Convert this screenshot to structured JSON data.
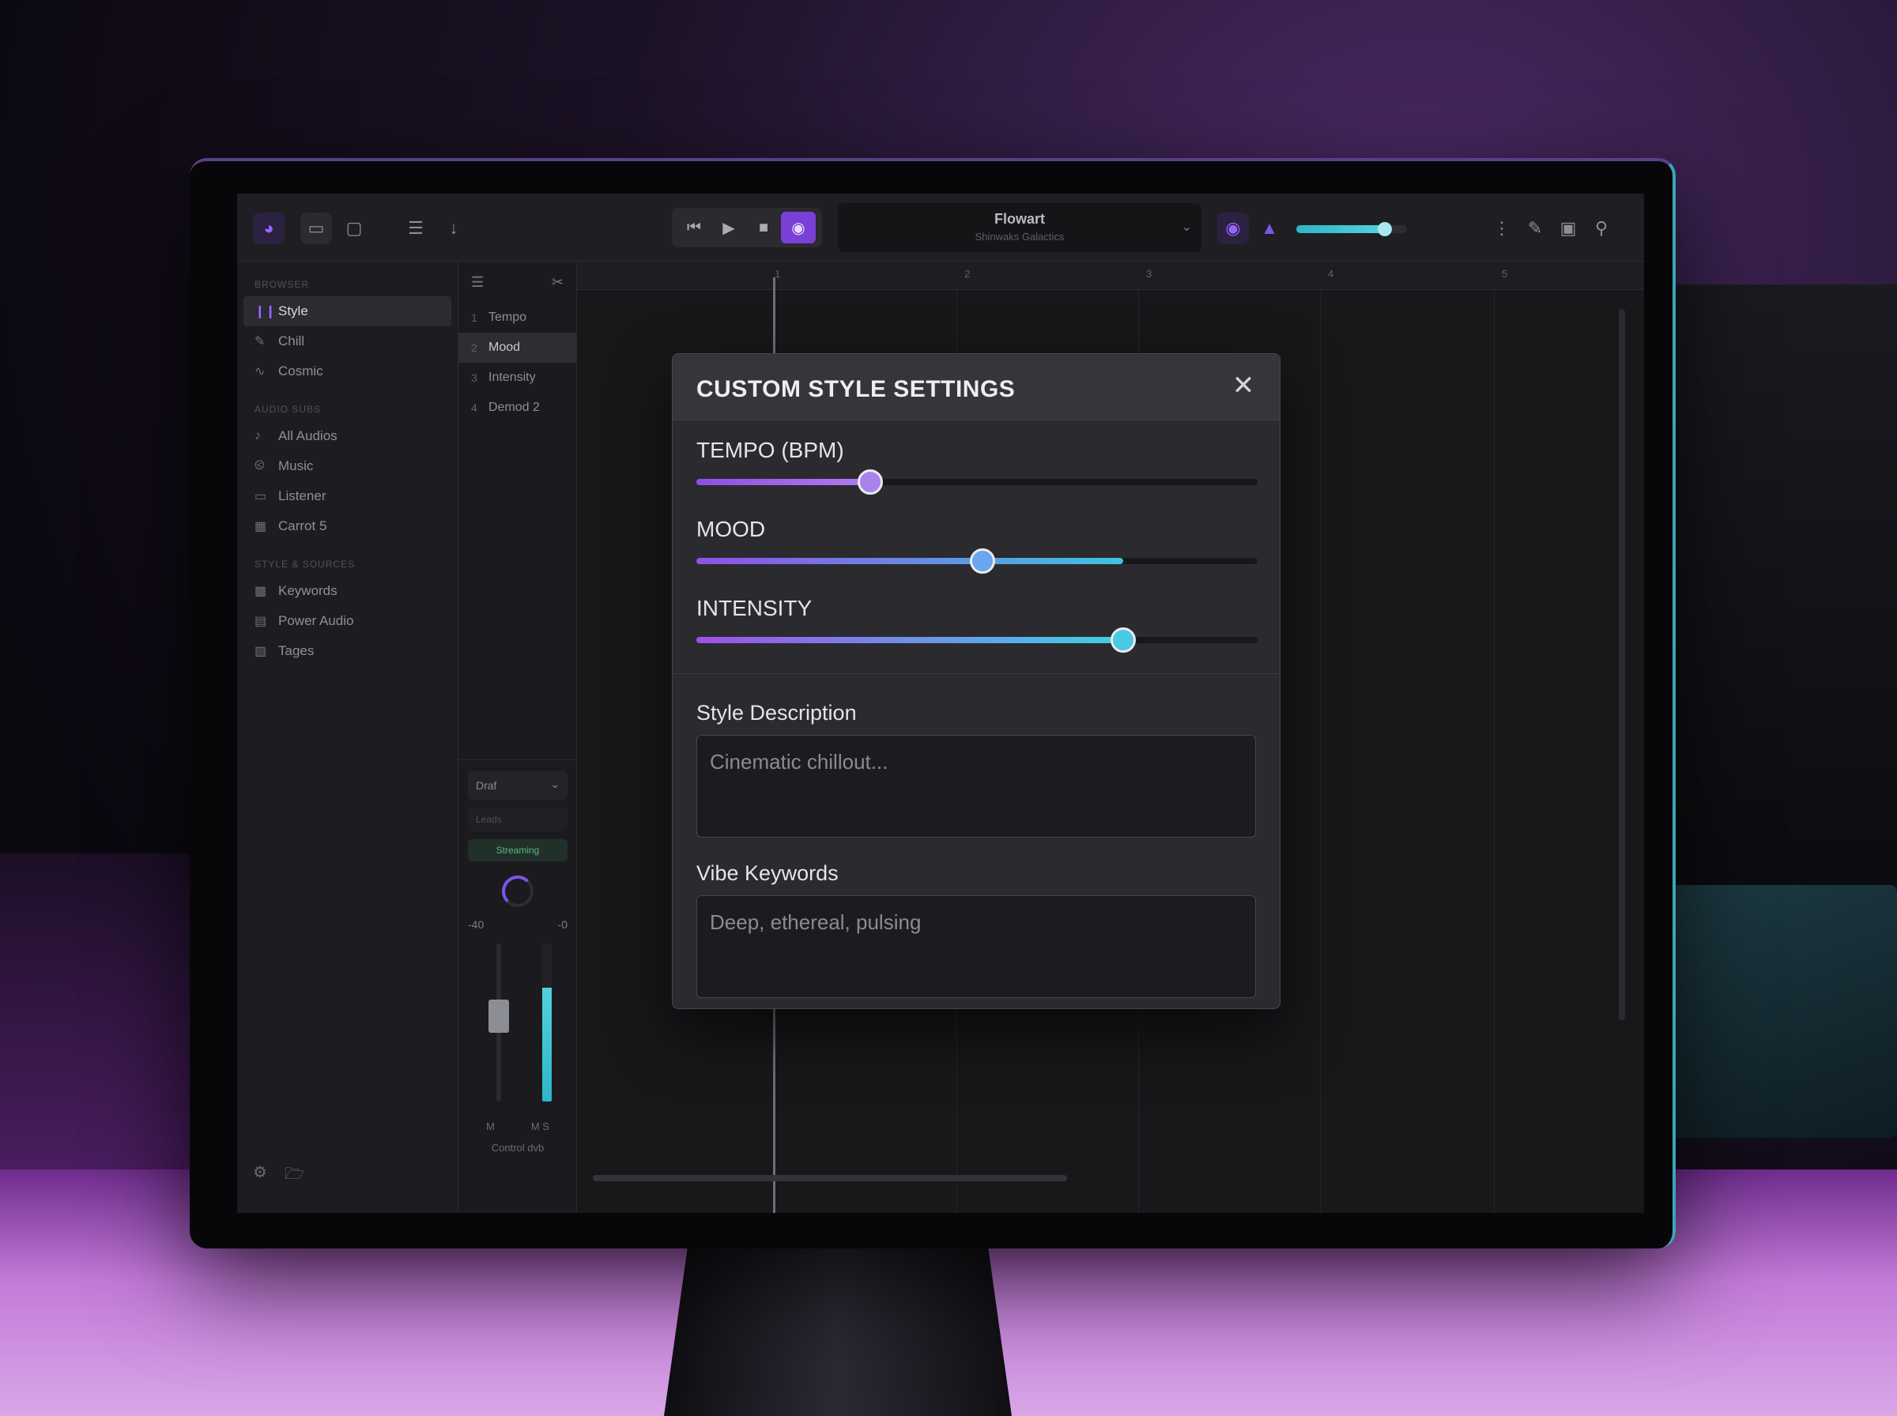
{
  "colors": {
    "accent_purple": "#9a62ff",
    "accent_cyan": "#2fb6c8",
    "panel_bg": "#2a2a2f"
  },
  "topbar": {
    "left_icons": [
      "app-logo-icon",
      "monitor-icon",
      "window-icon",
      "mixer-sliders-icon",
      "download-icon"
    ],
    "transport_icons": [
      "skip-back-icon",
      "play-icon",
      "stop-icon",
      "record-icon"
    ],
    "project_name": "Flowart",
    "project_sub": "Shinwaks Galactics",
    "master_volume_fraction": 0.8,
    "right_icons": [
      "more-icon",
      "edit-icon",
      "panel-icon",
      "search-icon"
    ]
  },
  "sidebar": {
    "sections": [
      {
        "title": "BROWSER",
        "items": [
          {
            "label": "Style",
            "icon": "bars-icon",
            "active": true
          },
          {
            "label": "Chill",
            "icon": "pencil-icon",
            "active": false
          },
          {
            "label": "Cosmic",
            "icon": "wave-icon",
            "active": false
          }
        ]
      },
      {
        "title": "AUDIO SUBS",
        "items": [
          {
            "label": "All Audios",
            "icon": "note-icon",
            "active": false
          },
          {
            "label": "Music",
            "icon": "radio-icon",
            "active": false
          },
          {
            "label": "Listener",
            "icon": "cast-icon",
            "active": false
          },
          {
            "label": "Carrot 5",
            "icon": "grid-icon",
            "active": false
          }
        ]
      },
      {
        "title": "STYLE & SOURCES",
        "items": [
          {
            "label": "Keywords",
            "icon": "people-icon",
            "active": false
          },
          {
            "label": "Power Audio",
            "icon": "layout-icon",
            "active": false
          },
          {
            "label": "Tages",
            "icon": "tags-icon",
            "active": false
          }
        ]
      }
    ],
    "footer_icons": [
      "gear-icon",
      "folder-icon"
    ]
  },
  "tracklist": {
    "items": [
      {
        "num": "1",
        "label": "Tempo",
        "active": false
      },
      {
        "num": "2",
        "label": "Mood",
        "active": true
      },
      {
        "num": "3",
        "label": "Intensity",
        "active": false
      },
      {
        "num": "4",
        "label": "Demod 2",
        "active": false
      }
    ],
    "channel": {
      "select": "Draf",
      "input_placeholder": "Leads",
      "badge": "Streaming",
      "val_left": "-40",
      "val_right": "-0",
      "fader_level": 0.55,
      "meter_level": 0.72,
      "mute": "M",
      "solo": "M S",
      "label": "Control dvb"
    }
  },
  "timeline": {
    "ruler_ticks": [
      "1",
      "2",
      "3",
      "4",
      "5"
    ]
  },
  "modal": {
    "title": "CUSTOM STYLE SETTINGS",
    "sliders": [
      {
        "label": "TEMPO (BPM)",
        "value": 0.31,
        "fill_to": 0.31,
        "fill_colors": [
          "#8f4fe0",
          "#b07cf0"
        ],
        "thumb_color": "#a982ee"
      },
      {
        "label": "MOOD",
        "value": 0.51,
        "fill_to": 0.76,
        "fill_colors": [
          "#9150e6",
          "#3fc3e0"
        ],
        "thumb_color": "#6aa6f0"
      },
      {
        "label": "INTENSITY",
        "value": 0.76,
        "fill_to": 0.76,
        "fill_colors": [
          "#a050e6",
          "#3fd0e6"
        ],
        "thumb_color": "#49c9e2"
      }
    ],
    "style_description": {
      "label": "Style Description",
      "placeholder": "Cinematic chillout..."
    },
    "vibe_keywords": {
      "label": "Vibe Keywords",
      "placeholder": "Deep, ethereal, pulsing"
    }
  }
}
